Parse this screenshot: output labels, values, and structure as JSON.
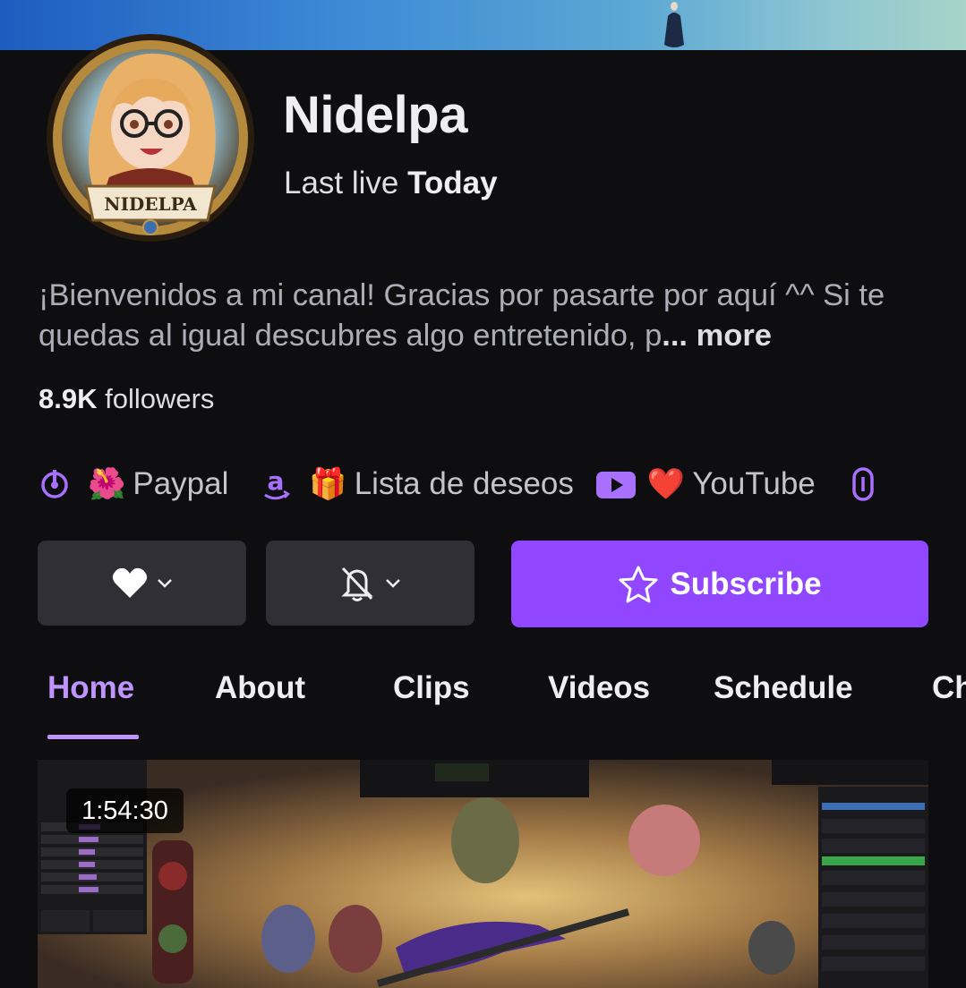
{
  "channel": {
    "name": "Nidelpa",
    "avatar_text": "NIDELPA",
    "last_live_label": "Last live",
    "last_live_value": "Today",
    "bio_text": "¡Bienvenidos a mi canal! Gracias por pasarte por aquí ^^ Si te quedas al igual descubres algo entretenido, p",
    "bio_ellipsis": "...",
    "bio_more": "more",
    "followers_count": "8.9K",
    "followers_label": "followers"
  },
  "links": [
    {
      "icon": "paypal-icon",
      "emoji": "🌺",
      "label": "Paypal"
    },
    {
      "icon": "amazon-icon",
      "emoji": "🎁",
      "label": "Lista de deseos"
    },
    {
      "icon": "youtube-icon",
      "emoji": "❤️",
      "label": "YouTube"
    },
    {
      "icon": "link-icon",
      "emoji": "",
      "label": ""
    }
  ],
  "actions": {
    "follow_icon": "heart-icon",
    "notify_icon": "bell-off-icon",
    "subscribe_label": "Subscribe",
    "subscribe_icon": "star-icon"
  },
  "tabs": [
    {
      "label": "Home",
      "active": true
    },
    {
      "label": "About",
      "active": false
    },
    {
      "label": "Clips",
      "active": false
    },
    {
      "label": "Videos",
      "active": false
    },
    {
      "label": "Schedule",
      "active": false
    },
    {
      "label": "Ch",
      "active": false
    }
  ],
  "video": {
    "duration": "1:54:30"
  },
  "colors": {
    "accent": "#9147ff",
    "accent_light": "#bf94ff",
    "background": "#0e0e10",
    "button_bg": "#2f2f35",
    "text_muted": "#adadb8"
  }
}
